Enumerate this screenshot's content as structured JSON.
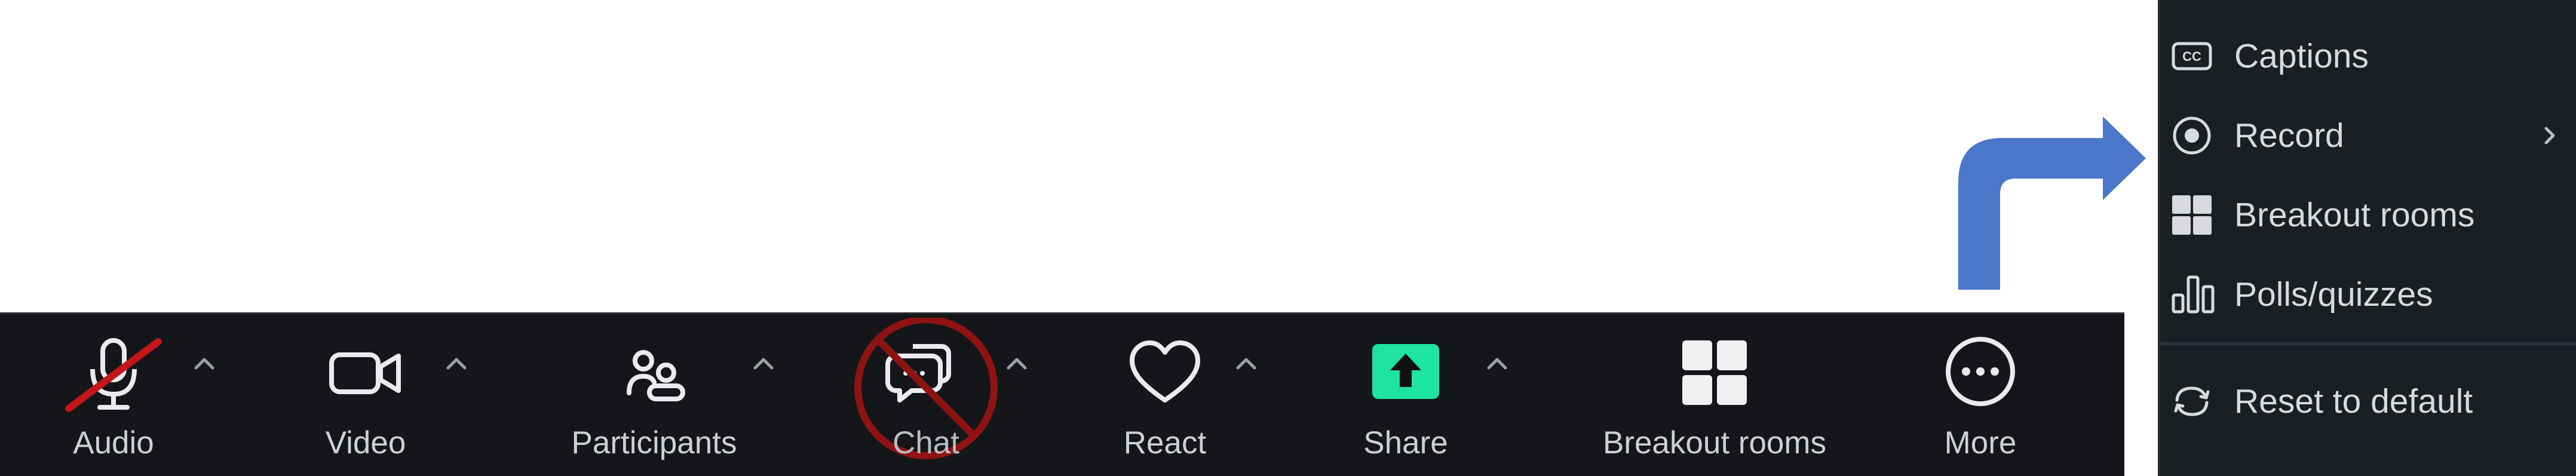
{
  "toolbar": {
    "audio_label": "Audio",
    "video_label": "Video",
    "participants_label": "Participants",
    "chat_label": "Chat",
    "react_label": "React",
    "share_label": "Share",
    "breakout_label": "Breakout rooms",
    "more_label": "More",
    "audio_muted": true,
    "chat_disabled": true,
    "share_color": "#1ee3a3"
  },
  "more_menu": {
    "items": [
      {
        "label": "Captions",
        "icon": "closed-captions-icon",
        "has_submenu": false
      },
      {
        "label": "Record",
        "icon": "record-icon",
        "has_submenu": true
      },
      {
        "label": "Breakout rooms",
        "icon": "breakout-rooms-icon",
        "has_submenu": false
      },
      {
        "label": "Polls/quizzes",
        "icon": "polls-icon",
        "has_submenu": false
      },
      {
        "label": "Reset to default",
        "icon": "reset-icon",
        "has_submenu": false
      }
    ]
  },
  "colors": {
    "toolbar_bg": "#141619",
    "menu_bg": "#1b1e22",
    "arrow": "#4a77c9",
    "strike_red": "#c4161c",
    "chat_circle": "#8f1313"
  }
}
